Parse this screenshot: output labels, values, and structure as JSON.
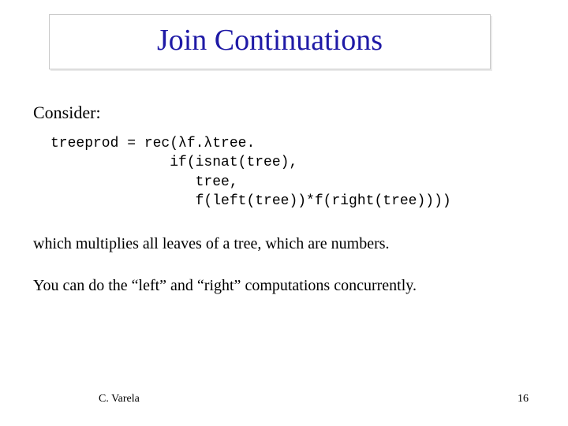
{
  "title": "Join Continuations",
  "consider": "Consider:",
  "code": "treeprod = rec(λf.λtree.\n              if(isnat(tree),\n                 tree,\n                 f(left(tree))*f(right(tree))))",
  "para1": "which multiplies all leaves of a tree, which are numbers.",
  "para2": "You can do the “left” and “right” computations concurrently.",
  "footer": {
    "author": "C. Varela",
    "page": "16"
  }
}
